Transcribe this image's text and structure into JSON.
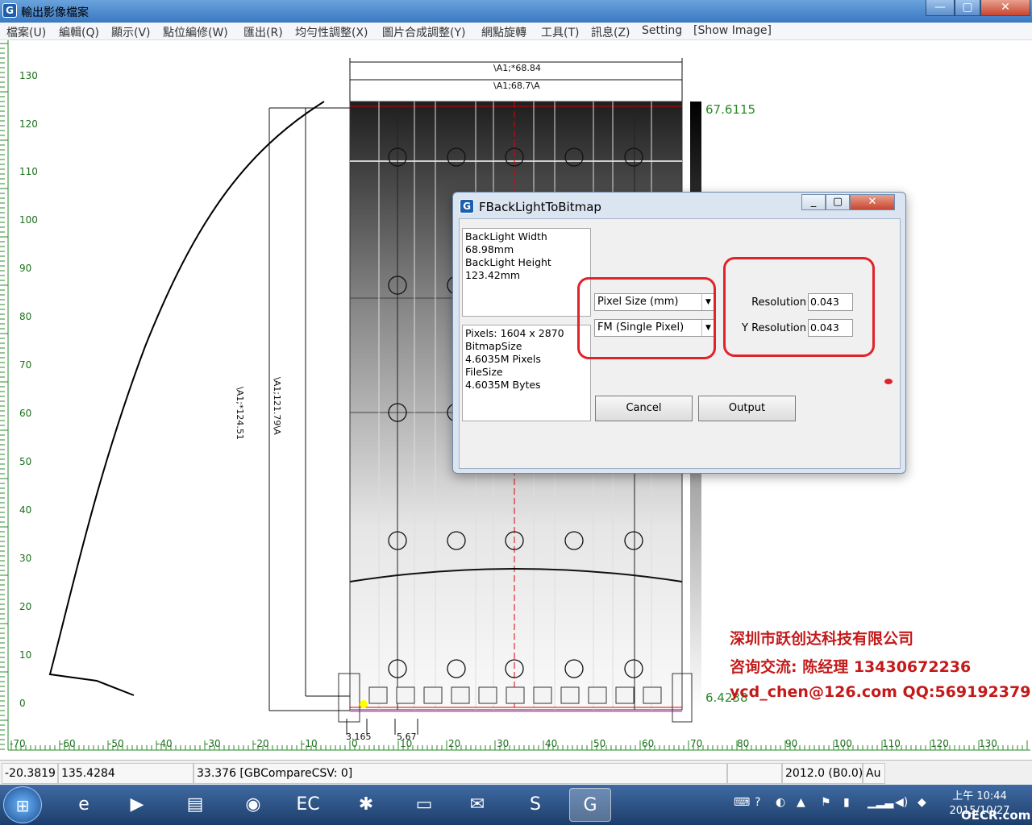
{
  "window": {
    "title": "輸出影像檔案"
  },
  "menu": [
    "檔案(U)",
    "編輯(Q)",
    "顯示(V)",
    "點位編修(W)",
    "匯出(R)",
    "均勻性調整(X)",
    "圖片合成調整(Y)",
    "網點旋轉",
    "工具(T)",
    "訊息(Z)",
    "Setting",
    "[Show Image]"
  ],
  "ruler": {
    "y_labels": [
      "130",
      "120",
      "110",
      "100",
      "90",
      "80",
      "70",
      "60",
      "50",
      "40",
      "30",
      "20",
      "10",
      "0"
    ],
    "x_labels": [
      "-70",
      "-60",
      "-50",
      "-40",
      "-30",
      "-20",
      "-10",
      "0",
      "10",
      "20",
      "30",
      "40",
      "50",
      "60",
      "70",
      "80",
      "90",
      "100",
      "110",
      "120",
      "130"
    ]
  },
  "drawing": {
    "dim_top1": "\\A1;*68.84",
    "dim_top2": "\\A1;68.7\\A",
    "dim_left1": "\\A1;*124.51",
    "dim_left2": "\\A1;121.79\\A",
    "dim_bottom1": "3.165",
    "dim_bottom2": "5.67",
    "value_top": "67.6115",
    "value_bottom": "6.4238"
  },
  "dialog": {
    "title": "FBackLightToBitmap",
    "info_top": [
      "BackLight Width",
      "68.98mm",
      "BackLight Height",
      "123.42mm"
    ],
    "info_bottom": [
      "Pixels: 1604 x 2870",
      "BitmapSize",
      "4.6035M Pixels",
      "FileSize",
      "4.6035M Bytes"
    ],
    "combo_unit": "Pixel Size (mm)",
    "combo_mode": "FM (Single Pixel)",
    "resolution_label": "Resolution",
    "resolution_value": "0.043",
    "yresolution_label": "Y Resolution",
    "yresolution_value": "0.043",
    "cancel_label": "Cancel",
    "output_label": "Output"
  },
  "watermark": {
    "line1": "深圳市跃创达科技有限公司",
    "line2": "咨询交流:  陈经理  13430672236",
    "line3": "ycd_chen@126.com    QQ:569192379"
  },
  "status": {
    "x": "-20.3819",
    "y": "135.4284",
    "info": "33.376 [GBCompareCSV: 0]",
    "version": "2012.0 (B0.0)",
    "extra": "Au"
  },
  "taskbar": {
    "clock_time": "上午 10:44",
    "clock_date": "2015/10/27",
    "watermark_site": "OECR.com"
  },
  "colors": {
    "accent": "#3a78c2",
    "highlight": "#e0232b",
    "ruler": "#2a8a2a"
  }
}
